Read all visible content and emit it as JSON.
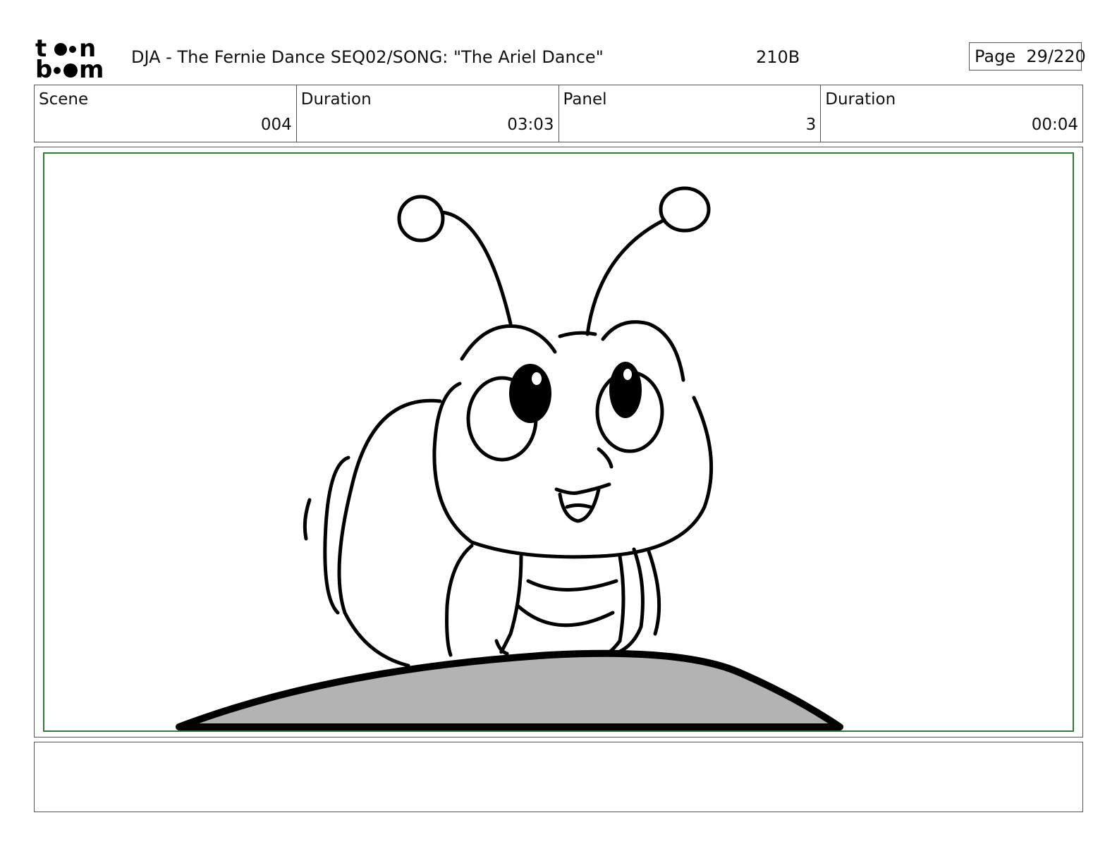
{
  "header": {
    "logo_text": "toon boom",
    "project_title": "DJA - The Fernie Dance  SEQ02/SONG: \"The Ariel Dance\"",
    "scene_code": "210B",
    "page_label": "Page",
    "page_number": "29/220"
  },
  "info": [
    {
      "label": "Scene",
      "value": "004"
    },
    {
      "label": "Duration",
      "value": "03:03"
    },
    {
      "label": "Panel",
      "value": "3"
    },
    {
      "label": "Duration",
      "value": "00:04"
    }
  ],
  "colors": {
    "safe_frame": "#2e7d32",
    "ground_fill": "#b3b3b3",
    "line": "#000000"
  }
}
